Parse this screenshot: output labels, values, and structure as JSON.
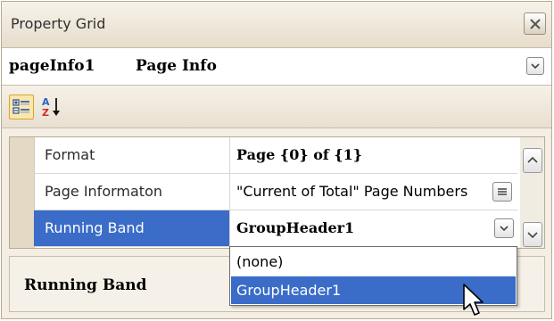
{
  "window": {
    "title": "Property Grid",
    "close_icon": "close-icon"
  },
  "object_selector": {
    "name": "pageInfo1",
    "type": "Page Info",
    "dropdown_icon": "chevron-down-icon"
  },
  "toolbar": {
    "categorized_icon": "categorized-view-icon",
    "alphabetical_icon": "sort-alphabetical-icon"
  },
  "properties": [
    {
      "name": "Format",
      "value": "Page {0} of {1}",
      "bold": true
    },
    {
      "name": "Page Informaton",
      "value": "\"Current of Total\" Page Numbers",
      "bold": false
    },
    {
      "name": "Running Band",
      "value": "GroupHeader1",
      "bold": true,
      "selected": true
    }
  ],
  "dropdown": {
    "options": [
      "(none)",
      "GroupHeader1"
    ],
    "highlighted": "GroupHeader1"
  },
  "description": {
    "title": "Running Band"
  },
  "colors": {
    "selection": "#3a6cc8",
    "panel_bg": "#f4eee4",
    "border": "#b7aa95"
  }
}
